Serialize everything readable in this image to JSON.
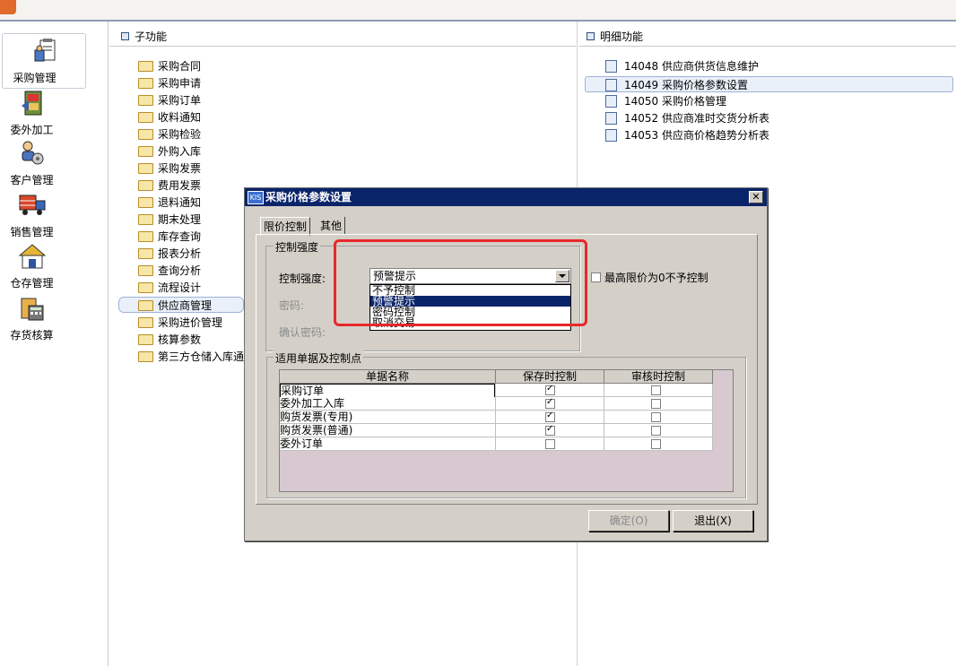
{
  "left_nav": {
    "items": [
      {
        "label": "采购管理",
        "icon": "purchase-icon"
      },
      {
        "label": "委外加工",
        "icon": "outsourcing-icon"
      },
      {
        "label": "客户管理",
        "icon": "customer-icon"
      },
      {
        "label": "销售管理",
        "icon": "sales-truck-icon"
      },
      {
        "label": "仓存管理",
        "icon": "warehouse-icon"
      },
      {
        "label": "存货核算",
        "icon": "calculator-icon"
      }
    ]
  },
  "sub_functions": {
    "title": "子功能",
    "items": [
      "采购合同",
      "采购申请",
      "采购订单",
      "收料通知",
      "采购检验",
      "外购入库",
      "采购发票",
      "费用发票",
      "退料通知",
      "期末处理",
      "库存查询",
      "报表分析",
      "查询分析",
      "流程设计",
      "供应商管理",
      "采购进价管理",
      "核算参数",
      "第三方仓储入库通:"
    ],
    "selected": "供应商管理"
  },
  "details": {
    "title": "明细功能",
    "items": [
      {
        "code": "14048",
        "label": "供应商供货信息维护"
      },
      {
        "code": "14049",
        "label": "采购价格参数设置"
      },
      {
        "code": "14050",
        "label": "采购价格管理"
      },
      {
        "code": "14052",
        "label": "供应商准时交货分析表"
      },
      {
        "code": "14053",
        "label": "供应商价格趋势分析表"
      }
    ],
    "selected": "14049"
  },
  "dialog": {
    "title": "采购价格参数设置",
    "logo_text": "KIS",
    "tabs": [
      "限价控制",
      "其他"
    ],
    "control_group": {
      "label": "控制强度",
      "field_label": "控制强度:",
      "selected": "预警提示",
      "options": [
        "不予控制",
        "预警提示",
        "密码控制",
        "取消交易"
      ],
      "password_label": "密码:",
      "confirm_label": "确认密码:"
    },
    "max_price_checkbox": {
      "label": "最高限价为0不予控制",
      "checked": false
    },
    "docs_group": {
      "label": "适用单据及控制点",
      "columns": [
        "单据名称",
        "保存时控制",
        "审核时控制"
      ],
      "rows": [
        {
          "name": "采购订单",
          "save": true,
          "audit": false
        },
        {
          "name": "委外加工入库",
          "save": true,
          "audit": false
        },
        {
          "name": "购货发票(专用)",
          "save": true,
          "audit": false
        },
        {
          "name": "购货发票(普通)",
          "save": true,
          "audit": false
        },
        {
          "name": "委外订单",
          "save": false,
          "audit": false
        }
      ]
    },
    "ok_button": "确定(O)",
    "exit_button": "退出(X)"
  },
  "colors": {
    "title_bar": "#0a246a",
    "highlight": "#e8272b",
    "dialog_bg": "#d4d0c8"
  }
}
